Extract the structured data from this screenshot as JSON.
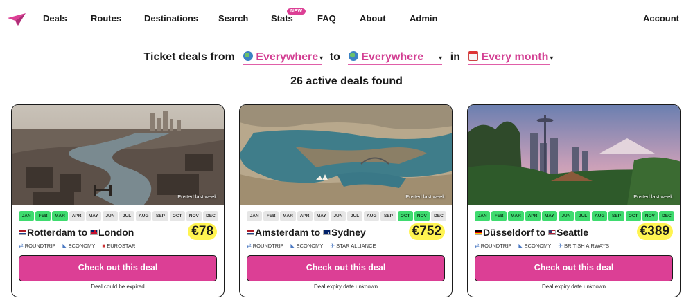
{
  "nav": {
    "items": [
      "Deals",
      "Routes",
      "Destinations",
      "Search",
      "Stats",
      "FAQ",
      "About",
      "Admin"
    ],
    "new_badge": "NEW",
    "account": "Account"
  },
  "filter": {
    "prefix": "Ticket deals from",
    "from_value": "Everywhere",
    "to_label": "to",
    "to_value": "Everywhere",
    "in_label": "in",
    "month_value": "Every month"
  },
  "results": {
    "count_text": "26 active deals found"
  },
  "month_labels": [
    "JAN",
    "FEB",
    "MAR",
    "APR",
    "MAY",
    "JUN",
    "JUL",
    "AUG",
    "SEP",
    "OCT",
    "NOV",
    "DEC"
  ],
  "cards": [
    {
      "posted": "Posted last week",
      "months_on": [
        true,
        true,
        true,
        false,
        false,
        false,
        false,
        false,
        false,
        false,
        false,
        false
      ],
      "from_city": "Rotterdam",
      "from_flag": "nl",
      "to_word": "to",
      "to_city": "London",
      "to_flag": "uk",
      "price": "€78",
      "tags": [
        "ROUNDTRIP",
        "ECONOMY",
        "EUROSTAR"
      ],
      "cta": "Check out this deal",
      "expiry": "Deal could be expired"
    },
    {
      "posted": "Posted last week",
      "months_on": [
        false,
        false,
        false,
        false,
        false,
        false,
        false,
        false,
        false,
        true,
        true,
        false
      ],
      "from_city": "Amsterdam",
      "from_flag": "nl",
      "to_word": "to",
      "to_city": "Sydney",
      "to_flag": "au",
      "price": "€752",
      "tags": [
        "ROUNDTRIP",
        "ECONOMY",
        "STAR ALLIANCE"
      ],
      "cta": "Check out this deal",
      "expiry": "Deal expiry date unknown"
    },
    {
      "posted": "Posted last week",
      "months_on": [
        true,
        true,
        true,
        true,
        true,
        true,
        true,
        true,
        true,
        true,
        true,
        true
      ],
      "from_city": "Düsseldorf",
      "from_flag": "de",
      "to_word": "to",
      "to_city": "Seattle",
      "to_flag": "us",
      "price": "€389",
      "tags": [
        "ROUNDTRIP",
        "ECONOMY",
        "BRITISH AIRWAYS"
      ],
      "cta": "Check out this deal",
      "expiry": "Deal expiry date unknown"
    }
  ],
  "colors": {
    "accent": "#dc3f95",
    "month_active": "#3fdb6f",
    "month_inactive": "#e6e6e6",
    "price_highlight": "#fff451"
  },
  "icons": [
    "paper-plane-logo",
    "globe-icon",
    "calendar-icon",
    "roundtrip-icon",
    "seat-icon",
    "plane-icon"
  ]
}
